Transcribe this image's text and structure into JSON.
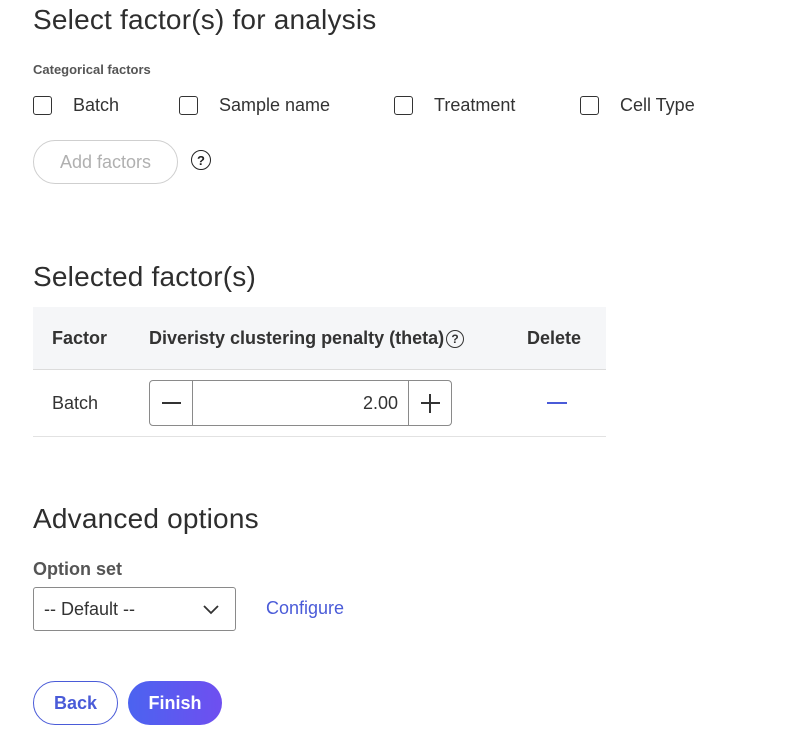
{
  "sections": {
    "select_title": "Select factor(s) for analysis",
    "selected_title": "Selected factor(s)",
    "advanced_title": "Advanced options"
  },
  "categorical": {
    "label": "Categorical factors",
    "items": [
      {
        "label": "Batch",
        "checked": false
      },
      {
        "label": "Sample name",
        "checked": false
      },
      {
        "label": "Treatment",
        "checked": false
      },
      {
        "label": "Cell Type",
        "checked": false
      }
    ],
    "add_button": "Add factors",
    "help_glyph": "?"
  },
  "table": {
    "headers": {
      "factor": "Factor",
      "theta": "Diveristy clustering penalty (theta)",
      "delete": "Delete"
    },
    "help_glyph": "?",
    "rows": [
      {
        "factor": "Batch",
        "theta": "2.00"
      }
    ]
  },
  "advanced": {
    "option_label": "Option set",
    "select_value": "-- Default --",
    "configure_link": "Configure"
  },
  "footer": {
    "back": "Back",
    "finish": "Finish"
  },
  "icons": {
    "checkbox": "checkbox-icon",
    "help": "help-circle-icon",
    "minus": "minus-icon",
    "plus": "plus-icon",
    "delete": "delete-dash-icon",
    "chevron": "chevron-down-icon"
  },
  "colors": {
    "accent": "#4a5bd8",
    "finish_gradient_start": "#4b63f0",
    "finish_gradient_end": "#6f4ff0",
    "table_header_bg": "#f5f6f8"
  }
}
